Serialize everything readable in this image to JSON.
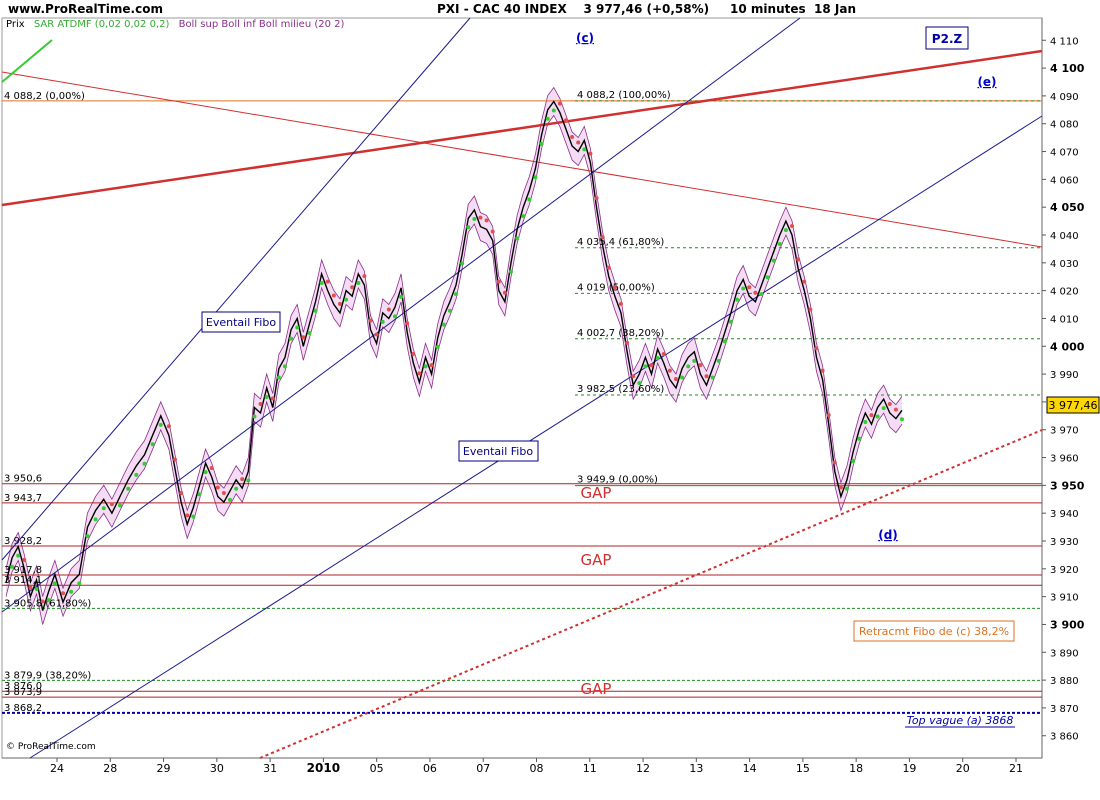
{
  "header": {
    "site": "www.ProRealTime.com",
    "instrument": "PXI - CAC 40 INDEX",
    "last": "3 977,46",
    "change": "(+0,58%)",
    "timeframe": "10 minutes",
    "date": "18 Jan"
  },
  "legend": {
    "price": "Prix",
    "sar": "SAR ATDMF (0,02 0,02 0,2)",
    "boll": "Boll sup Boll inf Boll milieu (20 2)"
  },
  "footer": "© ProRealTime.com",
  "colors": {
    "price": "#000000",
    "boll": "#8B2E8B",
    "boll_fill": "#F3D9F3",
    "sar_up": "#33CC33",
    "sar_down": "#E05050",
    "fan": "#1B1B8F",
    "trend": "#D03030",
    "fibo": "#228B22",
    "level": "#B22222",
    "gap": "#D03030",
    "annot": "#0000CC",
    "retr": "#E07020"
  },
  "chart_data": {
    "type": "line",
    "title": "PXI - CAC 40 INDEX",
    "ylim": [
      3852,
      4118
    ],
    "y_ticks": [
      3860,
      3870,
      3880,
      3890,
      3900,
      3910,
      3920,
      3930,
      3940,
      3950,
      3960,
      3970,
      3980,
      3990,
      4000,
      4010,
      4020,
      4030,
      4040,
      4050,
      4060,
      4070,
      4080,
      4090,
      4100,
      4110
    ],
    "y_tick_labels": [
      "3 860",
      "3 870",
      "3 880",
      "3 890",
      "3 900",
      "3 910",
      "3 920",
      "3 930",
      "3 940",
      "3 950",
      "3 960",
      "3 970",
      "3 980",
      "3 990",
      "4 000",
      "4 010",
      "4 020",
      "4 030",
      "4 040",
      "4 050",
      "4 060",
      "4 070",
      "4 080",
      "4 090",
      "4 100",
      "4 110"
    ],
    "bold_y_ticks": [
      3900,
      3950,
      4000,
      4050,
      4100
    ],
    "x_labels": [
      "24",
      "28",
      "29",
      "30",
      "31",
      "2010",
      "05",
      "06",
      "07",
      "08",
      "11",
      "12",
      "13",
      "14",
      "15",
      "18",
      "19",
      "20",
      "21"
    ],
    "last_price_label": "3 977,46",
    "price_path": [
      [
        0,
        3915
      ],
      [
        0.3,
        3924
      ],
      [
        0.6,
        3928
      ],
      [
        0.9,
        3920
      ],
      [
        1.2,
        3910
      ],
      [
        1.5,
        3916
      ],
      [
        1.8,
        3905
      ],
      [
        2.1,
        3912
      ],
      [
        2.4,
        3918
      ],
      [
        2.8,
        3908
      ],
      [
        3.2,
        3915
      ],
      [
        3.6,
        3918
      ],
      [
        4.0,
        3935
      ],
      [
        4.4,
        3941
      ],
      [
        4.8,
        3945
      ],
      [
        5.2,
        3940
      ],
      [
        5.6,
        3946
      ],
      [
        6.0,
        3952
      ],
      [
        6.4,
        3957
      ],
      [
        6.8,
        3961
      ],
      [
        7.2,
        3968
      ],
      [
        7.6,
        3975
      ],
      [
        8.0,
        3968
      ],
      [
        8.3,
        3956
      ],
      [
        8.6,
        3944
      ],
      [
        8.9,
        3936
      ],
      [
        9.2,
        3942
      ],
      [
        9.5,
        3950
      ],
      [
        9.8,
        3958
      ],
      [
        10.1,
        3953
      ],
      [
        10.4,
        3946
      ],
      [
        10.7,
        3944
      ],
      [
        11.0,
        3948
      ],
      [
        11.3,
        3952
      ],
      [
        11.6,
        3949
      ],
      [
        11.9,
        3955
      ],
      [
        12.2,
        3978
      ],
      [
        12.5,
        3976
      ],
      [
        12.8,
        3985
      ],
      [
        13.1,
        3978
      ],
      [
        13.4,
        3992
      ],
      [
        13.7,
        3996
      ],
      [
        14.0,
        4006
      ],
      [
        14.3,
        4010
      ],
      [
        14.6,
        4000
      ],
      [
        14.9,
        4008
      ],
      [
        15.2,
        4016
      ],
      [
        15.5,
        4026
      ],
      [
        15.8,
        4020
      ],
      [
        16.1,
        4015
      ],
      [
        16.4,
        4012
      ],
      [
        16.7,
        4020
      ],
      [
        17.0,
        4018
      ],
      [
        17.3,
        4026
      ],
      [
        17.6,
        4022
      ],
      [
        17.9,
        4006
      ],
      [
        18.2,
        4001
      ],
      [
        18.5,
        4012
      ],
      [
        18.8,
        4010
      ],
      [
        19.1,
        4014
      ],
      [
        19.4,
        4021
      ],
      [
        19.7,
        4005
      ],
      [
        20.0,
        3994
      ],
      [
        20.3,
        3987
      ],
      [
        20.6,
        3996
      ],
      [
        20.9,
        3990
      ],
      [
        21.2,
        4003
      ],
      [
        21.5,
        4011
      ],
      [
        21.8,
        4016
      ],
      [
        22.1,
        4022
      ],
      [
        22.4,
        4033
      ],
      [
        22.7,
        4046
      ],
      [
        23.0,
        4049
      ],
      [
        23.3,
        4043
      ],
      [
        23.6,
        4042
      ],
      [
        23.9,
        4038
      ],
      [
        24.2,
        4020
      ],
      [
        24.5,
        4016
      ],
      [
        24.8,
        4030
      ],
      [
        25.1,
        4042
      ],
      [
        25.4,
        4050
      ],
      [
        25.7,
        4056
      ],
      [
        26.0,
        4064
      ],
      [
        26.3,
        4076
      ],
      [
        26.6,
        4085
      ],
      [
        26.9,
        4088
      ],
      [
        27.2,
        4084
      ],
      [
        27.5,
        4078
      ],
      [
        27.8,
        4072
      ],
      [
        28.1,
        4070
      ],
      [
        28.4,
        4074
      ],
      [
        28.7,
        4066
      ],
      [
        29.0,
        4050
      ],
      [
        29.3,
        4036
      ],
      [
        29.6,
        4025
      ],
      [
        29.9,
        4018
      ],
      [
        30.2,
        4012
      ],
      [
        30.5,
        3998
      ],
      [
        30.8,
        3986
      ],
      [
        31.1,
        3990
      ],
      [
        31.4,
        3996
      ],
      [
        31.7,
        3990
      ],
      [
        32.0,
        3999
      ],
      [
        32.3,
        3994
      ],
      [
        32.6,
        3988
      ],
      [
        32.9,
        3985
      ],
      [
        33.2,
        3992
      ],
      [
        33.5,
        3996
      ],
      [
        33.8,
        3998
      ],
      [
        34.1,
        3990
      ],
      [
        34.4,
        3986
      ],
      [
        34.7,
        3992
      ],
      [
        35.0,
        3998
      ],
      [
        35.3,
        4005
      ],
      [
        35.6,
        4012
      ],
      [
        35.9,
        4020
      ],
      [
        36.2,
        4024
      ],
      [
        36.5,
        4018
      ],
      [
        36.8,
        4016
      ],
      [
        37.1,
        4022
      ],
      [
        37.4,
        4028
      ],
      [
        37.7,
        4034
      ],
      [
        38.0,
        4040
      ],
      [
        38.3,
        4045
      ],
      [
        38.6,
        4040
      ],
      [
        38.9,
        4028
      ],
      [
        39.2,
        4020
      ],
      [
        39.5,
        4010
      ],
      [
        39.8,
        3996
      ],
      [
        40.1,
        3988
      ],
      [
        40.4,
        3972
      ],
      [
        40.7,
        3955
      ],
      [
        41.0,
        3946
      ],
      [
        41.3,
        3952
      ],
      [
        41.6,
        3962
      ],
      [
        41.9,
        3970
      ],
      [
        42.2,
        3976
      ],
      [
        42.5,
        3972
      ],
      [
        42.8,
        3978
      ],
      [
        43.1,
        3981
      ],
      [
        43.4,
        3976
      ],
      [
        43.7,
        3974
      ],
      [
        44.0,
        3977
      ]
    ],
    "fibo_levels": [
      {
        "price": 4088.2,
        "label": "4 088,2 (100,00%)"
      },
      {
        "price": 4035.4,
        "label": "4 035,4 (61,80%)"
      },
      {
        "price": 4019,
        "label": "4 019 (50,00%)"
      },
      {
        "price": 4002.7,
        "label": "4 002,7 (38,20%)"
      },
      {
        "price": 3982.5,
        "label": "3 982,5 (23,60%)"
      },
      {
        "price": 3949.9,
        "label": "3 949,9 (0,00%)"
      }
    ],
    "horizontal_levels": [
      {
        "price": 4088.2,
        "label": "4 088,2 (0,00%)"
      },
      {
        "price": 3950.6,
        "label": "3 950,6"
      },
      {
        "price": 3943.7,
        "label": "3 943,7"
      },
      {
        "price": 3928.2,
        "label": "3 928,2"
      },
      {
        "price": 3917.8,
        "label": "3 917,8"
      },
      {
        "price": 3914.1,
        "label": "3 914,1"
      },
      {
        "price": 3905.8,
        "label": "3 905,8 (61,80%)"
      },
      {
        "price": 3879.9,
        "label": "3 879,9 (38,20%)"
      },
      {
        "price": 3876,
        "label": "3 876,0"
      },
      {
        "price": 3873.9,
        "label": "3 873,9"
      },
      {
        "price": 3868.2,
        "label": "3 868,2"
      }
    ],
    "annotations": {
      "wave_c": "(c)",
      "wave_d": "(d)",
      "wave_e": "(e)",
      "p2z": "P2.Z",
      "fan1": "Eventail Fibo",
      "fan2": "Eventail Fibo",
      "gap1": "GAP",
      "gap2": "GAP",
      "gap3": "GAP",
      "retr": "Retracmt Fibo de (c) 38,2%",
      "top_wave": "Top vague (a) 3868"
    }
  }
}
